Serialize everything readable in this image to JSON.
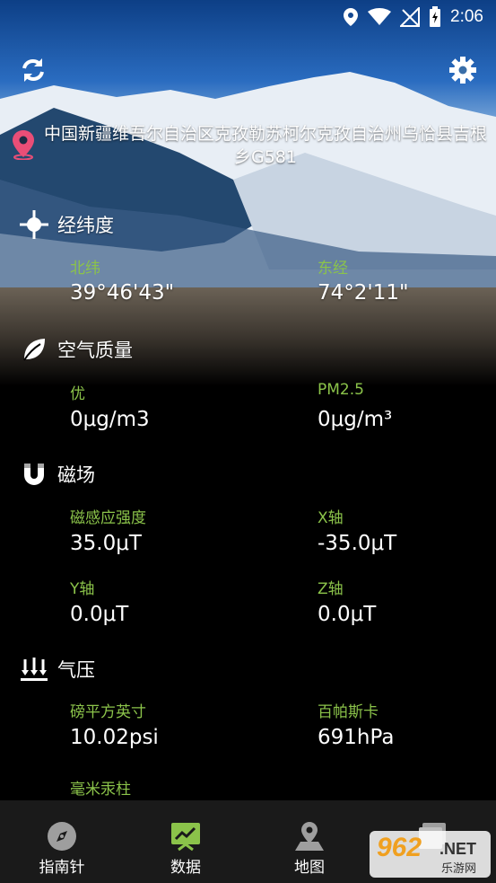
{
  "status": {
    "time": "2:06"
  },
  "location": {
    "address": "中国新疆维吾尔自治区克孜勒苏柯尔克孜自治州乌恰县吉根乡G581"
  },
  "sections": {
    "coords": {
      "title": "经纬度",
      "lat_label": "北纬",
      "lat_value": "39°46'43\"",
      "lng_label": "东经",
      "lng_value": "74°2'11\""
    },
    "air": {
      "title": "空气质量",
      "q_label": "优",
      "q_value": "0μg/m3",
      "pm_label": "PM2.5",
      "pm_value": "0μg/m³"
    },
    "magnetic": {
      "title": "磁场",
      "strength_label": "磁感应强度",
      "strength_value": "35.0μT",
      "x_label": "X轴",
      "x_value": "-35.0μT",
      "y_label": "Y轴",
      "y_value": "0.0μT",
      "z_label": "Z轴",
      "z_value": "0.0μT"
    },
    "pressure": {
      "title": "气压",
      "psi_label": "磅平方英寸",
      "psi_value": "10.02psi",
      "hpa_label": "百帕斯卡",
      "hpa_value": "691hPa",
      "mmhg_label": "毫米汞柱"
    }
  },
  "nav": {
    "compass": "指南针",
    "data": "数据",
    "map": "地图"
  },
  "watermark": {
    "logo": "962",
    "net": ".NET",
    "sub": "乐游网"
  },
  "colors": {
    "accent": "#8bc34a",
    "pin": "#e94e77",
    "nav_bg": "#1a1a1a"
  }
}
